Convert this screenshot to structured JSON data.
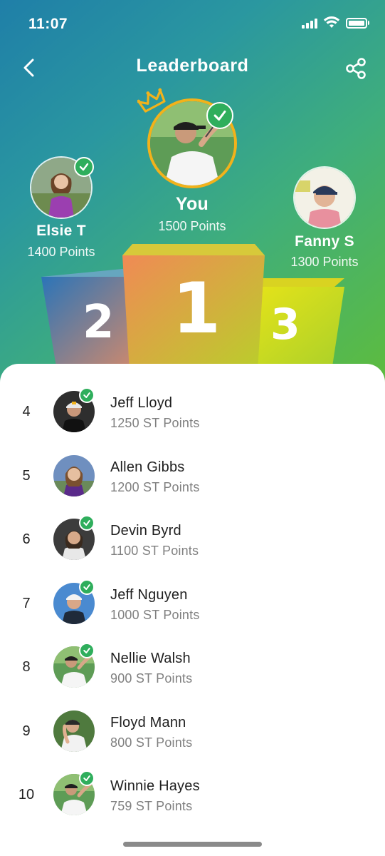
{
  "status_bar": {
    "time": "11:07"
  },
  "header": {
    "title": "Leaderboard",
    "back_icon": "chevron-left-icon",
    "share_icon": "share-icon"
  },
  "colors": {
    "gradient_start": "#1f7fa8",
    "gradient_end": "#5fbd3a",
    "verified_badge": "#2fae5c",
    "crown": "#f2b21b"
  },
  "podium": {
    "first": {
      "name": "You",
      "points": "1500 Points",
      "place": "1",
      "verified": true,
      "crown_icon": "crown-icon"
    },
    "second": {
      "name": "Elsie T",
      "points": "1400 Points",
      "place": "2",
      "verified": true
    },
    "third": {
      "name": "Fanny S",
      "points": "1300 Points",
      "place": "3",
      "verified": false
    }
  },
  "leaderboard": [
    {
      "rank": "4",
      "name": "Jeff Lloyd",
      "points": "1250 ST Points",
      "verified": true
    },
    {
      "rank": "5",
      "name": "Allen Gibbs",
      "points": "1200 ST Points",
      "verified": false
    },
    {
      "rank": "6",
      "name": "Devin Byrd",
      "points": "1100 ST Points",
      "verified": true
    },
    {
      "rank": "7",
      "name": "Jeff Nguyen",
      "points": "1000 ST Points",
      "verified": true
    },
    {
      "rank": "8",
      "name": "Nellie Walsh",
      "points": "900 ST Points",
      "verified": true
    },
    {
      "rank": "9",
      "name": "Floyd Mann",
      "points": "800 ST Points",
      "verified": false
    },
    {
      "rank": "10",
      "name": "Winnie Hayes",
      "points": "759 ST Points",
      "verified": true
    }
  ]
}
